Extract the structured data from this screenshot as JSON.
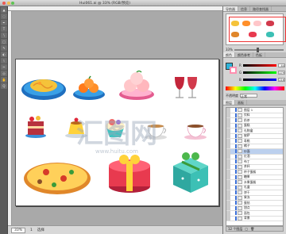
{
  "window": {
    "title": "Hui061.ai @ 33% (RGB/预览)"
  },
  "toolbox": {
    "tools": [
      "▲",
      "◌",
      "✒",
      "T",
      "\\",
      "□",
      "✎",
      "◐",
      "⌇",
      "✂",
      "◎",
      "✋",
      "Q"
    ]
  },
  "statusbar": {
    "zoom": "33%",
    "page": "1",
    "tool_label": "选择"
  },
  "panels": {
    "top_tabs": [
      "导航器",
      "信息",
      "路径查找器"
    ],
    "color_tabs": [
      "颜色",
      "颜色参考",
      "色板"
    ],
    "channels": [
      {
        "label": "R",
        "value": "44"
      },
      {
        "label": "G",
        "value": "179"
      },
      {
        "label": "B",
        "value": "216"
      }
    ],
    "opacity_label": "不透明度",
    "opacity_mode": "正常",
    "layers_tabs": [
      "图层",
      "画板"
    ],
    "layers": [
      {
        "name": "图层 1",
        "selected": false
      },
      {
        "name": "饮料",
        "selected": false
      },
      {
        "name": "奶茶",
        "selected": false
      },
      {
        "name": "蛋糕",
        "selected": false
      },
      {
        "name": "礼物盒",
        "selected": false
      },
      {
        "name": "披萨",
        "selected": false
      },
      {
        "name": "寿桃",
        "selected": false
      },
      {
        "name": "橘子",
        "selected": false
      },
      {
        "name": "炒面",
        "selected": true
      },
      {
        "name": "红酒",
        "selected": false
      },
      {
        "name": "布丁",
        "selected": false
      },
      {
        "name": "茶杯",
        "selected": false
      },
      {
        "name": "杯子蛋糕",
        "selected": false
      },
      {
        "name": "糖果",
        "selected": false
      },
      {
        "name": "水果蛋糕",
        "selected": false
      },
      {
        "name": "礼盒",
        "selected": false
      },
      {
        "name": "饼干",
        "selected": false
      },
      {
        "name": "果冻",
        "selected": false
      },
      {
        "name": "蛋挞",
        "selected": false
      },
      {
        "name": "甜点",
        "selected": false
      },
      {
        "name": "面包",
        "selected": false
      },
      {
        "name": "背景",
        "selected": false
      }
    ],
    "layers_count": "12 个图层"
  },
  "artboard": {
    "watermark_main": "汇图网",
    "watermark_url": "www.huitu.com"
  },
  "colors": {
    "fill": "#2cb3d8",
    "stroke": "#ff8fb0",
    "nav_frame": "#e33333",
    "selection": "#bcd0ee"
  }
}
